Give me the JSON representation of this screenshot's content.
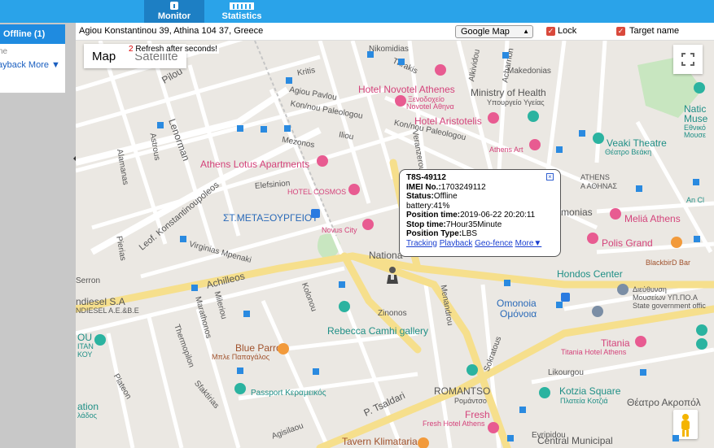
{
  "nav": {
    "monitor_label": "Monitor",
    "statistics_label": "Statistics"
  },
  "left": {
    "offline_header": "Offline (1)",
    "device_name_partial": "ne",
    "device_more": "ayback More ▼"
  },
  "toolbar": {
    "address": "Agiou Konstantinou 39, Athina 104 37, Greece",
    "map_provider": "Google Map",
    "lock_label": "Lock",
    "target_name_label": "Target name"
  },
  "map": {
    "maptype_map": "Map",
    "maptype_satellite": "Satellite",
    "refresh_count": "2",
    "refresh_text": "Refresh after seconds!",
    "labels": {
      "hotel_novotel": "Hotel Novotel Athenes",
      "novotel_gr": "Ξενοδοχείο",
      "novotel_gr2": "Novotel Αθηνα",
      "ministry": "Ministry of Health",
      "ministry_gr": "Υπουργείο Υγείας",
      "hotel_aristotelis": "Hotel Aristotelis",
      "athens_art": "Athens Art",
      "veaki": "Veaki Theatre",
      "veaki_gr": "Θέατρο Βεάκη",
      "museum_partial": "Natic",
      "museum_partial2": "Muse",
      "museum_gr": "Εθνικό",
      "museum_gr2": "Μουσε",
      "lotus": "Athens Lotus Apartments",
      "hotel_cosmos": "HOTEL COSMOS",
      "metaxourgeio": "ΣΤ.ΜΕΤΑΞΟΥΡΓΕΙΟΥ",
      "novus": "Novus City",
      "athens_gr": "ATHENS",
      "athens_gr2": "Α ΑΘΗΝΑΣ",
      "an_cl": "An Cl",
      "omonias": "monias",
      "melia": "Meliá Athens",
      "polis": "Polis Grand",
      "blackbird": "BlackbirD Bar",
      "national": "Nationa",
      "theatro": "ικό Θέατρο",
      "hondos": "Hondos Center",
      "dieuthinsi": "Διεύθυνση",
      "dieuthinsi2": "Μουσείων ΥΠ.ΠΟ.Α",
      "state_gov": "State government offic",
      "diesel": "ndiesel S.A",
      "diesel_gr": "NDIESEL A.E.&B.E",
      "achilleos": "Achilleos",
      "omonoia": "Omonoia",
      "omonoia_gr": "Ομόνοια",
      "rebecca": "Rebecca Camhi gallery",
      "blue_parrot": "Blue Parrot",
      "blue_parrot_gr": "Μπλε Παπαγάλος",
      "titania": "Titania",
      "titania_hotel": "Titania Hotel Athens",
      "ou": "ΟU",
      "ou2": "ΙΤΑΝ",
      "ou3": "ΚΟΥ",
      "passport": "Passport Κεραμεικός",
      "romantso": "ROMANTSO",
      "romantso_gr": "Ρομάντσο",
      "fresh": "Fresh",
      "fresh_hotel": "Fresh Hotel Athens",
      "kotzia": "Kotzia Square",
      "kotzia_gr": "Πλατεία Κοτζιά",
      "theatro_akropol": "Θέατρο Ακροπόλ",
      "ation": "ation",
      "ation2": "λάδος",
      "tavern": "Tavern Klimataria",
      "central": "Central Municipal",
      "tsaldari": "P. Tsaldari",
      "lenorman": "Lenorman",
      "leof": "Leof. Konstantinoupoleos",
      "street_kolonou": "Kolonou",
      "street_marathonos": "Marathonos",
      "street_mileriou": "Mileriou",
      "street_zinonos": "Zinonos",
      "street_sokratous": "Sokratous",
      "street_likourgou": "Likourgou",
      "street_evripidou": "Evripidou",
      "street_agiou_pavlou": "Agiou Pavlou",
      "street_kritis": "Kritis",
      "street_thrakis": "Thrakis",
      "street_nikomidias": "Nikomidias",
      "street_makedonias": "Makedonias",
      "street_mezonos": "Mezonos",
      "street_iliou": "Iliou",
      "street_elefsinion": "Elefsinion",
      "street_virginias": "Virginias Mpenaki",
      "street_kon_paleologou": "Kon/nou Paleologou",
      "street_acharnon": "Acharnon",
      "street_aristotelous": "Aristotelous",
      "street_alkividou": "Alkividou",
      "street_serron": "Serron",
      "street_plateon": "Plateon",
      "street_sfaktirias": "Sfaktirias",
      "street_thermopylon": "Thermopilon",
      "street_agisilaou": "Agisilaou",
      "street_pierias": "Pierias",
      "street_astrous": "Astrous",
      "street_alamanas": "Alamanas",
      "street_pilou": "Pilou",
      "street_satovriandou": "Satovriandou",
      "street_veranzerou": "Veranzerou",
      "street_koumoundourou": "Koumoundourou",
      "street_menandrou": "Menandrou",
      "street_epikourou": "Epikourou",
      "street_tosiza": "Tosiza",
      "street_grigoriou": "Grigoriou",
      "street_kerameikou": "Kerameikou"
    }
  },
  "popup": {
    "device_id": "T8S-49112",
    "imei_label": "IMEI No.:",
    "imei_value": "1703249112",
    "status_label": "Status:",
    "status_value": "Offline",
    "battery": "battery:41%",
    "position_time_label": "Position time:",
    "position_time_value": "2019-06-22 20:20:11",
    "stop_time_label": "Stop time:",
    "stop_time_value": "7Hour35Minute",
    "position_type_label": "Position Type:",
    "position_type_value": "LBS",
    "link_tracking": "Tracking",
    "link_playback": "Playback",
    "link_geofence": "Geo-fence",
    "link_more": "More▼"
  },
  "colors": {
    "nav_bg": "#2aa3e9",
    "nav_active": "#1d7fc4",
    "map_bg": "#e9e7e2",
    "road_major": "#f8e7a0",
    "checkbox": "#d9493c"
  }
}
